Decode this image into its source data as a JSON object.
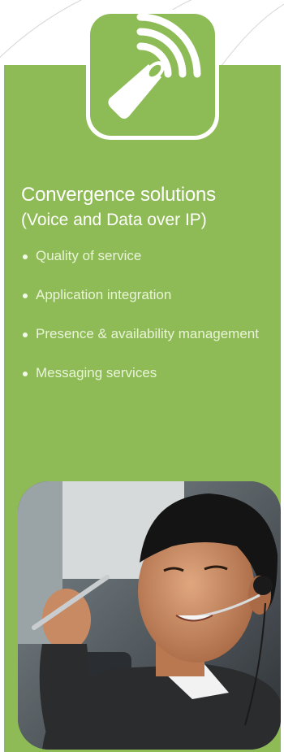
{
  "colors": {
    "panel_green": "#8ebb55",
    "text_white": "#ffffff"
  },
  "icon": {
    "name": "megaphone-broadcast-icon"
  },
  "heading": {
    "title": "Convergence solutions",
    "subtitle": "(Voice and Data over IP)"
  },
  "bullets": [
    "Quality of service",
    "Application integration",
    "Presence & availability management",
    "Messaging services"
  ],
  "photo": {
    "subject": "person-with-headset-photo"
  }
}
